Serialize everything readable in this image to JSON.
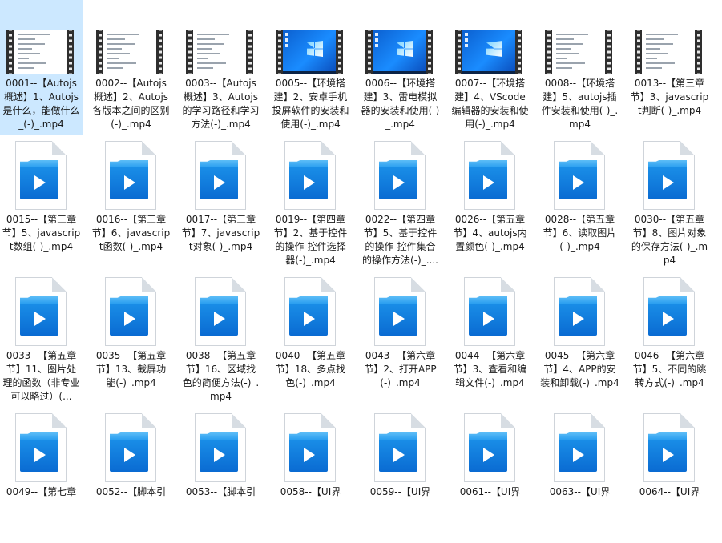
{
  "files": [
    {
      "name": "0001--【Autojs概述】1、Autojs是什么，能做什么_(-)_.mp4",
      "thumb": "video-doc",
      "selected": true
    },
    {
      "name": "0002--【Autojs概述】2、Autojs各版本之间的区别(-)_.mp4",
      "thumb": "video-doc"
    },
    {
      "name": "0003--【Autojs概述】3、Autojs的学习路径和学习方法(-)_.mp4",
      "thumb": "video-doc"
    },
    {
      "name": "0005--【环境搭建】2、安卓手机投屏软件的安装和使用(-)_.mp4",
      "thumb": "video-desktop"
    },
    {
      "name": "0006--【环境搭建】3、雷电模拟器的安装和使用(-)_.mp4",
      "thumb": "video-desktop"
    },
    {
      "name": "0007--【环境搭建】4、VScode编辑器的安装和使用(-)_.mp4",
      "thumb": "video-desktop"
    },
    {
      "name": "0008--【环境搭建】5、autojs插件安装和使用(-)_.mp4",
      "thumb": "video-doc"
    },
    {
      "name": "0013--【第三章节】3、javascript判断(-)_.mp4",
      "thumb": "video-doc"
    },
    {
      "name": "0015--【第三章节】5、javascript数组(-)_.mp4",
      "thumb": "file-video-icon"
    },
    {
      "name": "0016--【第三章节】6、javascript函数(-)_.mp4",
      "thumb": "file-video-icon"
    },
    {
      "name": "0017--【第三章节】7、javascript对象(-)_.mp4",
      "thumb": "file-video-icon"
    },
    {
      "name": "0019--【第四章节】2、基于控件的操作-控件选择器(-)_.mp4",
      "thumb": "file-video-icon"
    },
    {
      "name": "0022--【第四章节】5、基于控件的操作-控件集合的操作方法(-)_....",
      "thumb": "file-video-icon"
    },
    {
      "name": "0026--【第五章节】4、autojs内置颜色(-)_.mp4",
      "thumb": "file-video-icon"
    },
    {
      "name": "0028--【第五章节】6、读取图片(-)_.mp4",
      "thumb": "file-video-icon"
    },
    {
      "name": "0030--【第五章节】8、图片对象的保存方法(-)_.mp4",
      "thumb": "file-video-icon"
    },
    {
      "name": "0033--【第五章节】11、图片处理的函数（非专业可以略过）(...",
      "thumb": "file-video-icon"
    },
    {
      "name": "0035--【第五章节】13、截屏功能(-)_.mp4",
      "thumb": "file-video-icon"
    },
    {
      "name": "0038--【第五章节】16、区域找色的简便方法(-)_.mp4",
      "thumb": "file-video-icon"
    },
    {
      "name": "0040--【第五章节】18、多点找色(-)_.mp4",
      "thumb": "file-video-icon"
    },
    {
      "name": "0043--【第六章节】2、打开APP(-)_.mp4",
      "thumb": "file-video-icon"
    },
    {
      "name": "0044--【第六章节】3、查看和编辑文件(-)_.mp4",
      "thumb": "file-video-icon"
    },
    {
      "name": "0045--【第六章节】4、APP的安装和卸载(-)_.mp4",
      "thumb": "file-video-icon"
    },
    {
      "name": "0046--【第六章节】5、不同的跳转方式(-)_.mp4",
      "thumb": "file-video-icon"
    },
    {
      "name": "0049--【第七章",
      "thumb": "file-video-icon"
    },
    {
      "name": "0052--【脚本引",
      "thumb": "file-video-icon"
    },
    {
      "name": "0053--【脚本引",
      "thumb": "file-video-icon"
    },
    {
      "name": "0058--【UI界",
      "thumb": "file-video-icon"
    },
    {
      "name": "0059--【UI界",
      "thumb": "file-video-icon"
    },
    {
      "name": "0061--【UI界",
      "thumb": "file-video-icon"
    },
    {
      "name": "0063--【UI界",
      "thumb": "file-video-icon"
    },
    {
      "name": "0064--【UI界",
      "thumb": "file-video-icon"
    }
  ],
  "colors": {
    "selection": "#cce8ff",
    "video_badge": "#0a6bd2",
    "desktop_wallpaper": "#1a8cff"
  }
}
